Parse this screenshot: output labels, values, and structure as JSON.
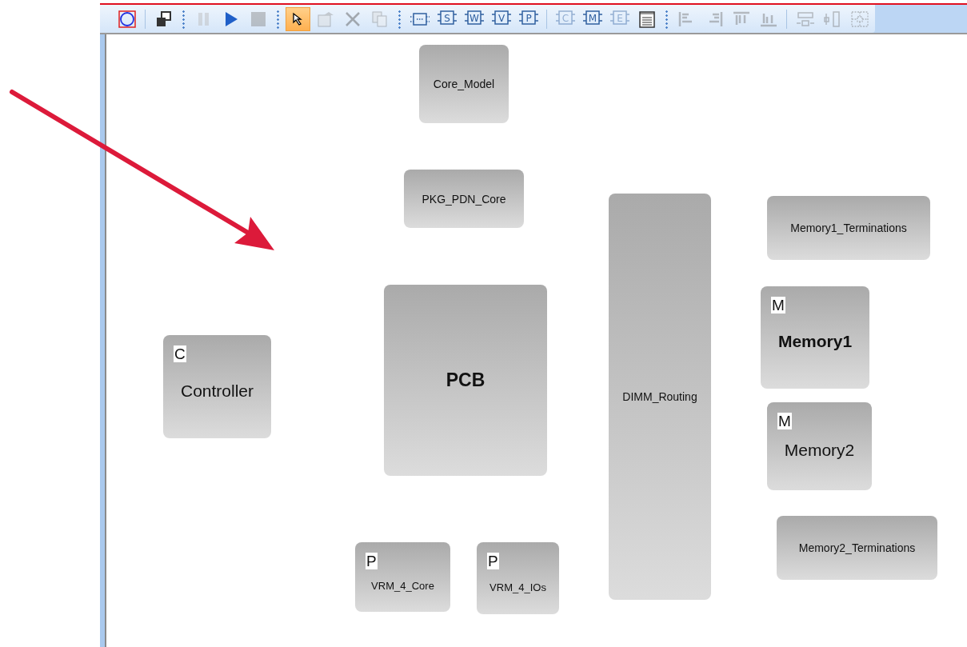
{
  "toolbar": {
    "items": [
      {
        "kind": "select-shape",
        "selected": false,
        "disabled": false
      },
      {
        "kind": "separator"
      },
      {
        "kind": "windows",
        "selected": false,
        "disabled": false
      },
      {
        "kind": "grip"
      },
      {
        "kind": "pause",
        "selected": false,
        "disabled": true
      },
      {
        "kind": "play",
        "selected": false,
        "disabled": false
      },
      {
        "kind": "stop",
        "selected": false,
        "disabled": true
      },
      {
        "kind": "grip"
      },
      {
        "kind": "pointer",
        "selected": true,
        "disabled": false
      },
      {
        "kind": "properties",
        "selected": false,
        "disabled": true
      },
      {
        "kind": "delete",
        "selected": false,
        "disabled": true
      },
      {
        "kind": "copy",
        "selected": false,
        "disabled": true
      },
      {
        "kind": "grip"
      },
      {
        "kind": "block",
        "selected": false,
        "disabled": false
      },
      {
        "kind": "letter-block",
        "letter": "S",
        "selected": false,
        "disabled": false
      },
      {
        "kind": "letter-block",
        "letter": "W",
        "selected": false,
        "disabled": false
      },
      {
        "kind": "letter-block",
        "letter": "V",
        "selected": false,
        "disabled": false
      },
      {
        "kind": "letter-block",
        "letter": "P",
        "selected": false,
        "disabled": false
      },
      {
        "kind": "separator"
      },
      {
        "kind": "letter-block",
        "letter": "C",
        "selected": false,
        "disabled": true
      },
      {
        "kind": "letter-block",
        "letter": "M",
        "selected": false,
        "disabled": false
      },
      {
        "kind": "letter-block",
        "letter": "E",
        "selected": false,
        "disabled": true
      },
      {
        "kind": "notepad",
        "selected": false,
        "disabled": false
      },
      {
        "kind": "grip"
      },
      {
        "kind": "align-left",
        "selected": false,
        "disabled": true
      },
      {
        "kind": "align-right",
        "selected": false,
        "disabled": true
      },
      {
        "kind": "align-top",
        "selected": false,
        "disabled": true
      },
      {
        "kind": "align-bottom",
        "selected": false,
        "disabled": true
      },
      {
        "kind": "separator"
      },
      {
        "kind": "space-across",
        "selected": false,
        "disabled": true
      },
      {
        "kind": "space-down",
        "selected": false,
        "disabled": true
      },
      {
        "kind": "space-both",
        "selected": false,
        "disabled": true
      }
    ]
  },
  "canvas": {
    "blocks": [
      {
        "label": "Core_Model",
        "bold": false
      },
      {
        "label": "PKG_PDN_Core",
        "bold": false
      },
      {
        "label": "DIMM_Routing",
        "bold": false
      },
      {
        "label": "Memory1_Terminations",
        "bold": false
      },
      {
        "label": "PCB",
        "bold": true
      },
      {
        "label": "Memory1",
        "badge": "M",
        "bold": true
      },
      {
        "label": "Controller",
        "badge": "C",
        "bold": false
      },
      {
        "label": "Memory2",
        "badge": "M",
        "bold": false
      },
      {
        "label": "Memory2_Terminations",
        "bold": false
      },
      {
        "label": "VRM_4_Core",
        "badge": "P",
        "bold": false
      },
      {
        "label": "VRM_4_IOs",
        "badge": "P",
        "bold": false
      }
    ]
  }
}
